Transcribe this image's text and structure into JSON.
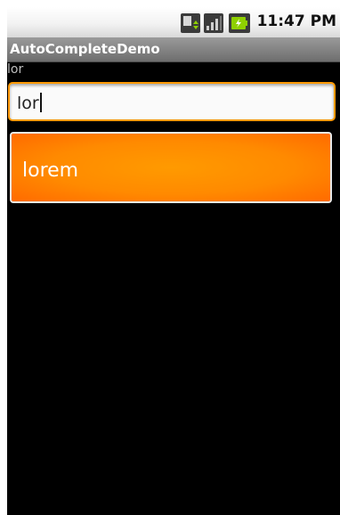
{
  "status_bar": {
    "time": "11:47 PM",
    "icons": [
      "sim-activity-icon",
      "signal-icon",
      "battery-charging-icon"
    ]
  },
  "app": {
    "title": "AutoCompleteDemo"
  },
  "selection_label": "lor",
  "input": {
    "value": "lor"
  },
  "suggestions": [
    "lorem"
  ],
  "colors": {
    "focus_orange": "#ff9a00",
    "title_bar": "#7a7a7a",
    "background": "#000000"
  }
}
